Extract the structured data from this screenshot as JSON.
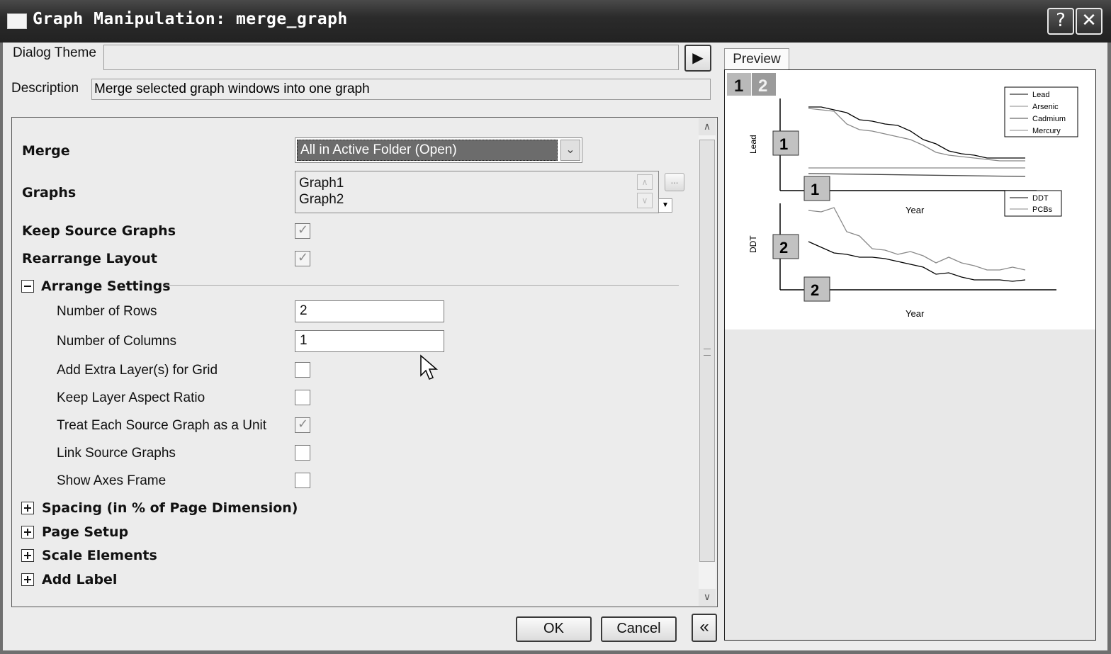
{
  "window": {
    "title": "Graph Manipulation: merge_graph",
    "help": "?",
    "close": "✕"
  },
  "dialog_theme": {
    "label": "Dialog Theme",
    "value": "",
    "arrow": "▶"
  },
  "description": {
    "label": "Description",
    "value": "Merge selected graph windows into one graph"
  },
  "merge": {
    "label": "Merge",
    "value": "All in Active Folder (Open)",
    "arrow": "⌄"
  },
  "graphs": {
    "label": "Graphs",
    "items": [
      "Graph1",
      "Graph2"
    ],
    "browse": "..."
  },
  "keep_source": {
    "label": "Keep Source Graphs",
    "checked": true
  },
  "rearrange": {
    "label": "Rearrange Layout",
    "checked": true
  },
  "arrange": {
    "label": "Arrange Settings",
    "rows": {
      "label": "Number of Rows",
      "value": "2"
    },
    "cols": {
      "label": "Number of Columns",
      "value": "1"
    },
    "extra_layer": {
      "label": "Add Extra Layer(s) for Grid",
      "checked": false
    },
    "aspect": {
      "label": "Keep Layer Aspect Ratio",
      "checked": false
    },
    "unit": {
      "label": "Treat Each Source Graph as a Unit",
      "checked": true
    },
    "link": {
      "label": "Link Source Graphs",
      "checked": false
    },
    "axes_frame": {
      "label": "Show Axes Frame",
      "checked": false
    }
  },
  "sections": [
    "Spacing (in % of Page Dimension)",
    "Page Setup",
    "Scale Elements",
    "Add Label"
  ],
  "buttons": {
    "ok": "OK",
    "cancel": "Cancel",
    "collapse": "«"
  },
  "preview": {
    "tab": "Preview",
    "badges": [
      "1",
      "2"
    ],
    "legend1": [
      "Lead",
      "Arsenic",
      "Cadmium",
      "Mercury"
    ],
    "legend2": [
      "DDT",
      "PCBs"
    ],
    "ylabel1": "Lead",
    "ylabel2": "DDT",
    "xlabel": "Year",
    "layer_labels": [
      "1",
      "1",
      "2",
      "2"
    ]
  }
}
